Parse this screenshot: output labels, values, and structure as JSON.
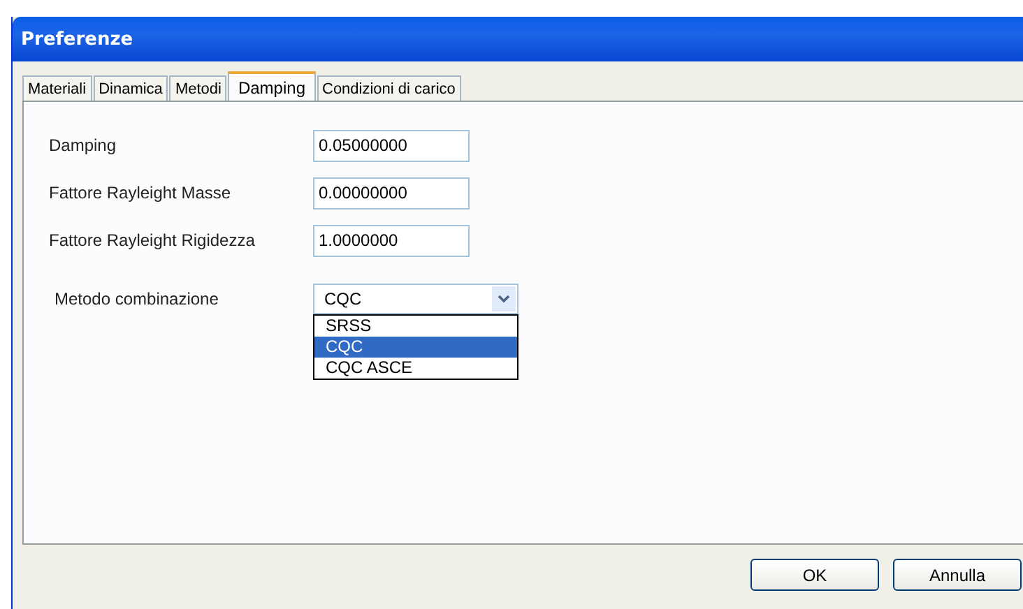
{
  "window": {
    "title": "Preferenze"
  },
  "tabs": [
    {
      "label": "Materiali",
      "selected": false
    },
    {
      "label": "Dinamica",
      "selected": false
    },
    {
      "label": "Metodi",
      "selected": false
    },
    {
      "label": "Damping",
      "selected": true
    },
    {
      "label": "Condizioni di carico",
      "selected": false
    }
  ],
  "fields": [
    {
      "label": "Damping",
      "value": "0.05000000"
    },
    {
      "label": "Fattore Rayleight Masse",
      "value": "0.00000000"
    },
    {
      "label": "Fattore Rayleight Rigidezza",
      "value": "1.0000000"
    }
  ],
  "combo": {
    "label": "Metodo combinazione",
    "value": "CQC",
    "expanded": true,
    "options": [
      {
        "label": "SRSS",
        "selected": false
      },
      {
        "label": "CQC",
        "selected": true
      },
      {
        "label": "CQC ASCE",
        "selected": false
      }
    ]
  },
  "buttons": [
    "OK",
    "Annulla"
  ]
}
